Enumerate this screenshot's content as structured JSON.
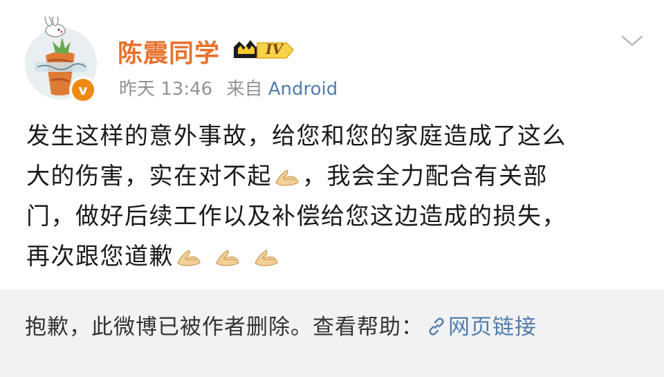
{
  "post": {
    "username": "陈震同学",
    "level_badge": "IV",
    "verified_badge": "v",
    "time": "昨天 13:46",
    "source_prefix": "来自",
    "source": "Android",
    "content_lines": [
      "发生这样的意外事故，给您和您的家庭造成了这么",
      "大的伤害，实在对不起",
      "，我会全力配合有关部",
      "门，做好后续工作以及补偿给您这边造成的损失，",
      "再次跟您道歉"
    ],
    "emoji": "praying-hands-icon"
  },
  "notice": {
    "text": "抱歉，此微博已被作者删除。查看帮助：",
    "link_label": "网页链接"
  },
  "colors": {
    "username": "#e8712c",
    "link": "#507daf",
    "meta": "#939393",
    "verified": "#ee8a12",
    "notice_bg": "#f2f2f2"
  }
}
